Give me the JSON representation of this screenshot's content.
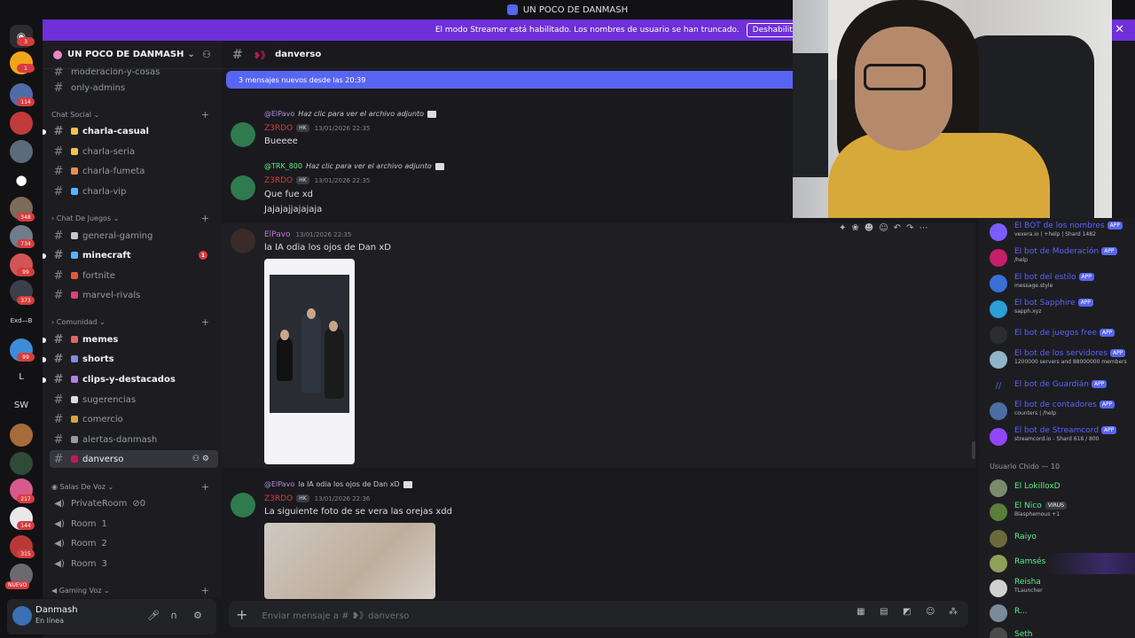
{
  "window": {
    "title": "UN POCO DE DANMASH"
  },
  "banner": {
    "text": "El modo Streamer está habilitado. Los nombres de usuario se han truncado.",
    "button": "Deshabilitar"
  },
  "guild_badges": [
    "3",
    "1",
    "114",
    "348",
    "734",
    "99",
    "373",
    "99",
    "217",
    "144",
    "315"
  ],
  "guild_labels": {
    "l": "L",
    "sw": "SW",
    "nuevo": "NUEVO",
    "exd": "Exd—B"
  },
  "server": {
    "name": "UN POCO DE DANMASH"
  },
  "channels_top": {
    "partial": "moderacion-y-cosas",
    "only_admins": "only-admins"
  },
  "categories": {
    "social": "Chat Social",
    "juegos": "Chat De Juegos",
    "comunidad": "Comunidad",
    "voz": "Salas De Voz",
    "gaming_voz": "Gaming Voz"
  },
  "channels": {
    "charla_casual": "charla-casual",
    "charla_seria": "charla-seria",
    "charla_fumeta": "charla-fumeta",
    "charla_vip": "charla-vip",
    "general_gaming": "general-gaming",
    "minecraft": "minecraft",
    "minecraft_badge": "1",
    "fortnite": "fortnite",
    "marvel": "marvel-rivals",
    "memes": "memes",
    "shorts": "shorts",
    "clips": "clips-y-destacados",
    "sugerencias": "sugerencias",
    "comercio": "comercio",
    "alertas": "alertas-danmash",
    "danverso": "danverso"
  },
  "voice": {
    "private": "PrivateRoom",
    "private_count": "0",
    "room1": "Room",
    "room1_n": "1",
    "room2": "Room",
    "room2_n": "2",
    "room3": "Room",
    "room3_n": "3"
  },
  "user": {
    "name": "Danmash",
    "status": "En línea"
  },
  "channel_header": {
    "name": "danverso"
  },
  "new_messages": "3 mensajes nuevos desde las 20:39",
  "messages": [
    {
      "reply_to": "@ElPavo",
      "reply_text": "Haz clic para ver el archivo adjunto",
      "author": "Z3RDO",
      "badge": "HK",
      "time": "13/01/2026 22:35",
      "lines": [
        "Bueeee"
      ]
    },
    {
      "reply_to": "@TRK_800",
      "reply_text": "Haz clic para ver el archivo adjunto",
      "author": "Z3RDO",
      "badge": "HK",
      "time": "13/01/2026 22:35",
      "lines": [
        "Que fue xd",
        "Jajajajjajajaja"
      ]
    },
    {
      "author": "ElPavo",
      "time": "13/01/2026 22:35",
      "lines": [
        "la IA odia los ojos de Dan xD"
      ]
    },
    {
      "reply_to": "@ElPavo",
      "reply_text": "la IA odia los ojos de Dan xD",
      "author": "Z3RDO",
      "badge": "HK",
      "time": "13/01/2026 22:36",
      "lines": [
        "La siguiente foto de se vera las orejas xdd"
      ]
    }
  ],
  "composer": {
    "placeholder": "Enviar mensaje a # ❥》danverso"
  },
  "apps": [
    {
      "name": "El BOT de los nombres",
      "sub": "vexera.io | +help | Shard 1482",
      "tag": "APP",
      "color": "#7b5cff"
    },
    {
      "name": "El bot de Moderación",
      "sub": "/help",
      "tag": "APP",
      "color": "#c41f6b"
    },
    {
      "name": "El bot del estilo",
      "sub": "message.style",
      "tag": "APP",
      "color": "#3a6fd8"
    },
    {
      "name": "El bot Sapphire",
      "sub": "sapph.xyz",
      "tag": "APP",
      "color": "#2a9fd8"
    },
    {
      "name": "El bot de juegos free",
      "sub": "",
      "tag": "APP",
      "color": "#2b2d31"
    },
    {
      "name": "El bot de los servidores",
      "sub": "1200000 servers and 88000000 members",
      "tag": "APP",
      "color": "#8fb5c9"
    },
    {
      "name": "El bot de Guardián",
      "sub": "",
      "tag": "APP",
      "color": "#1a3fd1"
    },
    {
      "name": "El bot de contadores",
      "sub": "counters | /help",
      "tag": "APP",
      "color": "#4a6fa5"
    },
    {
      "name": "El bot de Streamcord",
      "sub": "streamcord.io - Shard 618 / 800",
      "tag": "APP",
      "color": "#9146ff"
    }
  ],
  "member_group": "Usuario Chido — 10",
  "members": [
    {
      "name": "El LokilloxD",
      "sub": "",
      "color": "#57f287"
    },
    {
      "name": "El Nico",
      "sub": "Blasphemous +1",
      "tag": "VIRUS",
      "color": "#57f287"
    },
    {
      "name": "Raiyo",
      "sub": "",
      "color": "#57f287"
    },
    {
      "name": "Ramsés",
      "sub": "",
      "color": "#57f287"
    },
    {
      "name": "Reisha",
      "sub": "TLauncher",
      "color": "#57f287"
    },
    {
      "name": "R...",
      "sub": "",
      "color": "#57f287"
    },
    {
      "name": "Seth",
      "sub": "",
      "color": "#57f287"
    }
  ]
}
